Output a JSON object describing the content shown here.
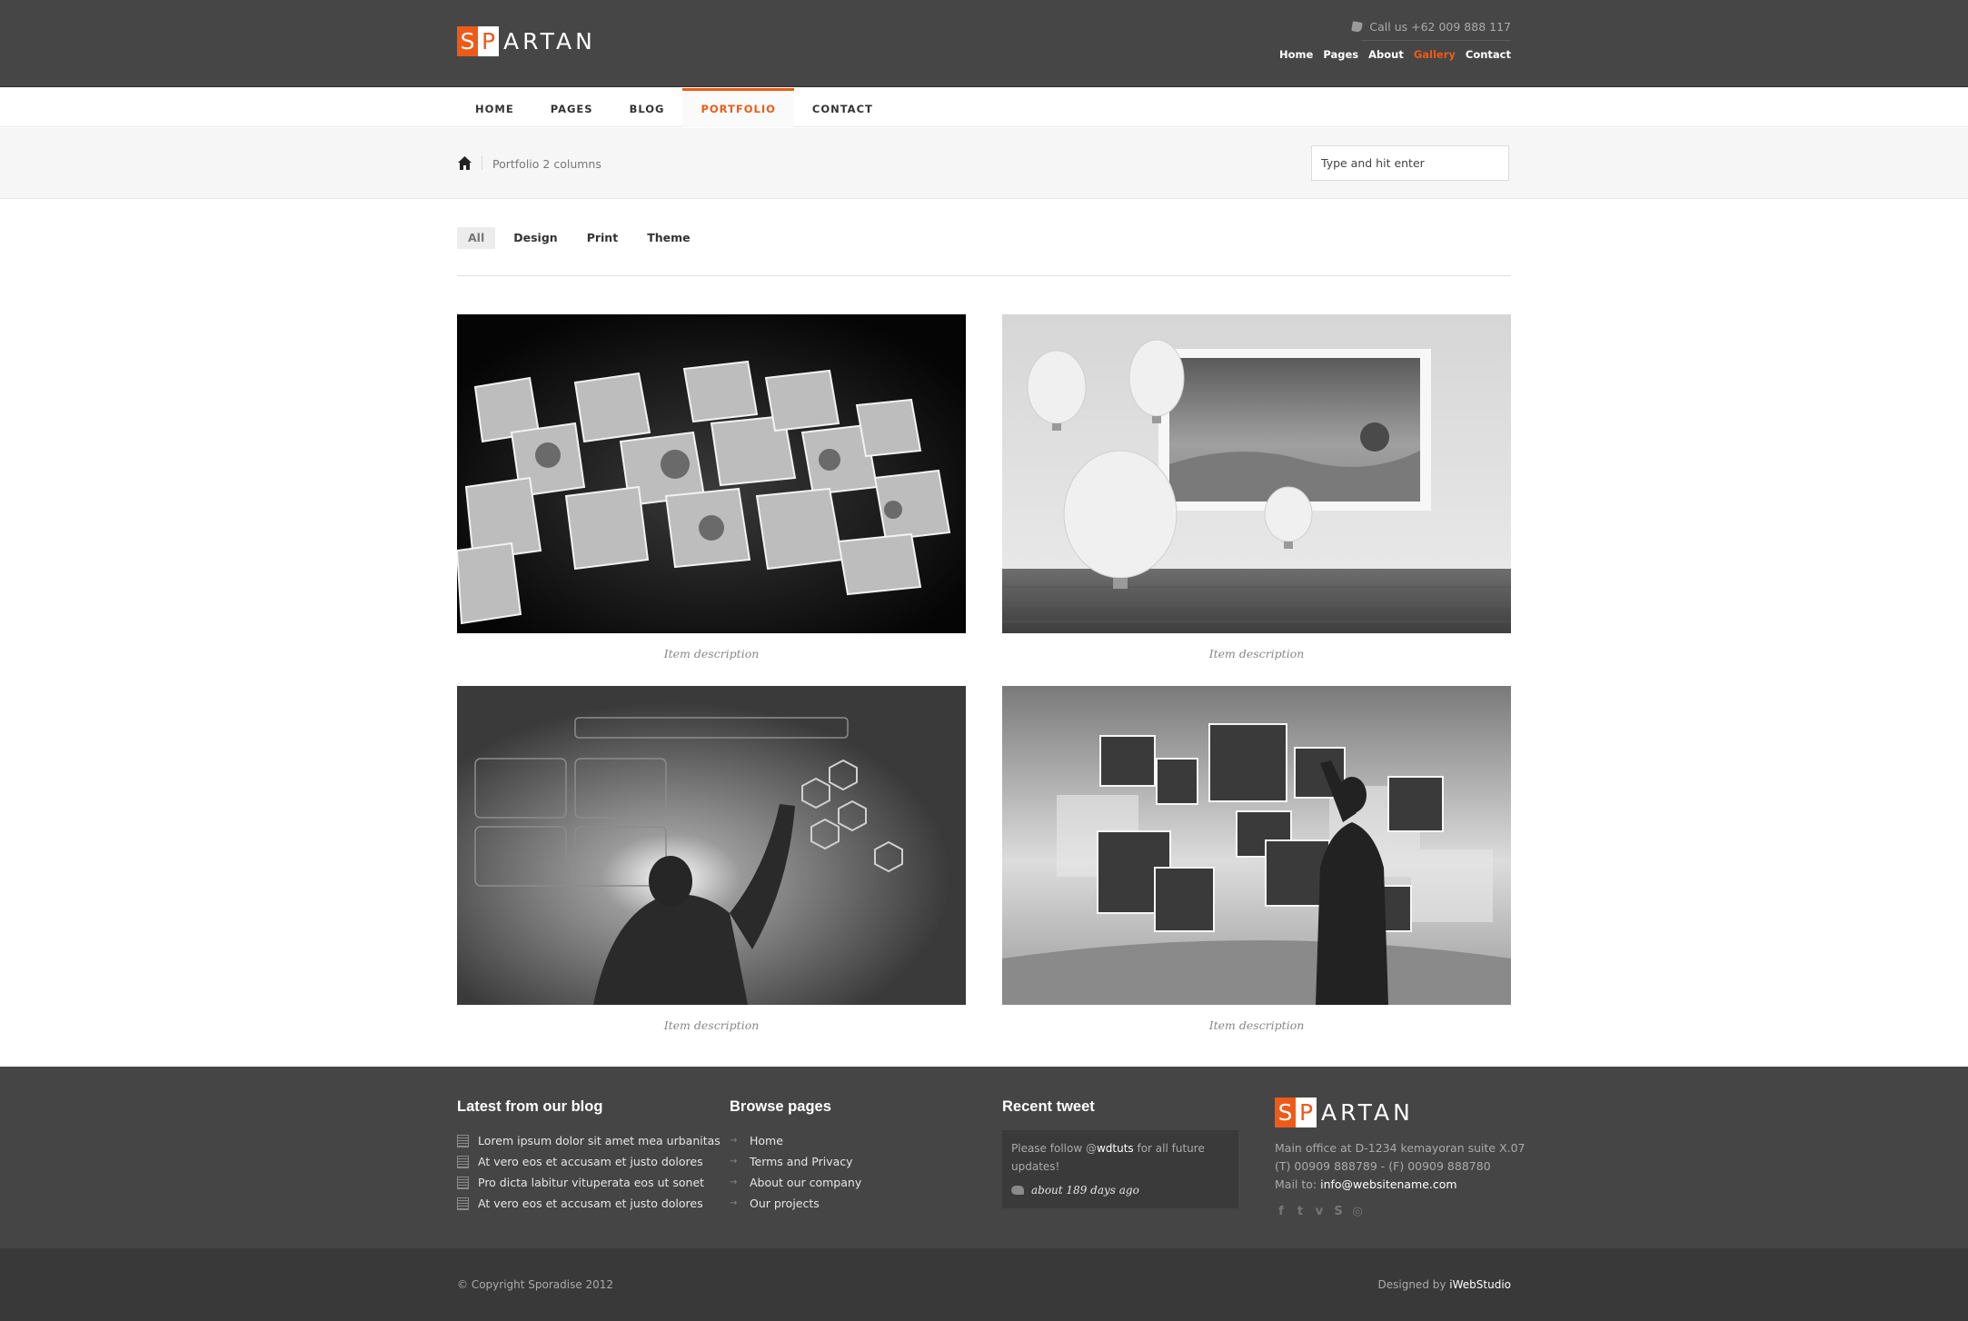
{
  "brand": {
    "logo_s": "S",
    "logo_p": "P",
    "logo_rest": "ARTAN"
  },
  "header": {
    "call_text": "Call us +62 009 888 117",
    "top_nav": [
      "Home",
      "Pages",
      "About",
      "Gallery",
      "Contact"
    ],
    "top_nav_active": "Gallery"
  },
  "main_nav": {
    "items": [
      "HOME",
      "PAGES",
      "BLOG",
      "PORTFOLIO",
      "CONTACT"
    ],
    "active": "PORTFOLIO"
  },
  "breadcrumb": {
    "current": "Portfolio 2 columns"
  },
  "search": {
    "placeholder": "Type and hit enter"
  },
  "filters": {
    "items": [
      "All",
      "Design",
      "Print",
      "Theme"
    ],
    "active": "All"
  },
  "portfolio": {
    "items": [
      {
        "caption": "Item description"
      },
      {
        "caption": "Item description"
      },
      {
        "caption": "Item description"
      },
      {
        "caption": "Item description"
      }
    ]
  },
  "footer": {
    "blog": {
      "title": "Latest from our blog",
      "posts": [
        "Lorem ipsum dolor sit amet mea urbanitas",
        "At vero eos et accusam et justo dolores",
        "Pro dicta labitur vituperata eos ut sonet",
        "At vero eos et accusam et justo dolores"
      ]
    },
    "browse": {
      "title": "Browse pages",
      "links": [
        "Home",
        "Terms and Privacy",
        "About our company",
        "Our projects"
      ]
    },
    "tweet": {
      "title": "Recent tweet",
      "text_before": "Please follow @",
      "handle": "wdtuts",
      "text_after": " for all future updates!",
      "time": "about 189 days ago"
    },
    "contact": {
      "address": "Main office at D-1234 kemayoran suite X.07",
      "phones": "(T) 00909 888789 - (F) 00909 888780",
      "mail_label": "Mail to: ",
      "mail": "info@websitename.com",
      "socials": [
        "facebook-icon",
        "twitter-icon",
        "vimeo-icon",
        "skype-icon",
        "dribbble-icon"
      ]
    },
    "copyright": "© Copyright Sporadise 2012",
    "designed_by_label": "Designed by ",
    "designed_by": "iWebStudio"
  }
}
